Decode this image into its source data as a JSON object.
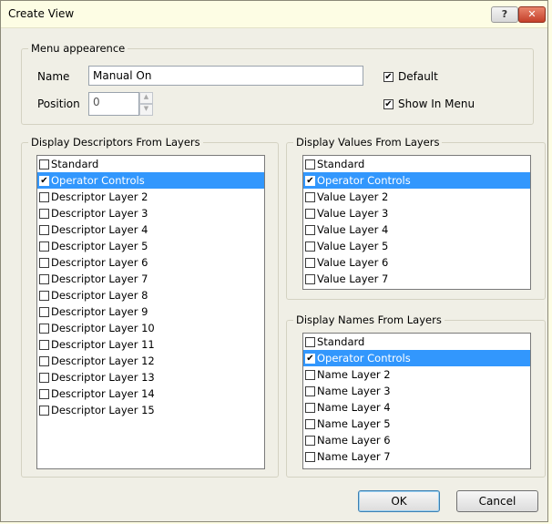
{
  "window": {
    "title": "Create View",
    "help_glyph": "?",
    "close_glyph": "✕"
  },
  "menu_appearance": {
    "group_label": "Menu appearence",
    "name_label": "Name",
    "name_value": "Manual On",
    "position_label": "Position",
    "position_value": "0",
    "default_label": "Default",
    "default_checked": true,
    "show_in_menu_label": "Show In Menu",
    "show_in_menu_checked": true
  },
  "descriptors": {
    "group_label": "Display Descriptors From Layers",
    "items": [
      {
        "label": "Standard",
        "checked": false,
        "selected": false
      },
      {
        "label": "Operator Controls",
        "checked": true,
        "selected": true
      },
      {
        "label": "Descriptor Layer 2",
        "checked": false,
        "selected": false
      },
      {
        "label": "Descriptor Layer 3",
        "checked": false,
        "selected": false
      },
      {
        "label": "Descriptor Layer 4",
        "checked": false,
        "selected": false
      },
      {
        "label": "Descriptor Layer 5",
        "checked": false,
        "selected": false
      },
      {
        "label": "Descriptor Layer 6",
        "checked": false,
        "selected": false
      },
      {
        "label": "Descriptor Layer 7",
        "checked": false,
        "selected": false
      },
      {
        "label": "Descriptor Layer 8",
        "checked": false,
        "selected": false
      },
      {
        "label": "Descriptor Layer 9",
        "checked": false,
        "selected": false
      },
      {
        "label": "Descriptor Layer 10",
        "checked": false,
        "selected": false
      },
      {
        "label": "Descriptor Layer 11",
        "checked": false,
        "selected": false
      },
      {
        "label": "Descriptor Layer 12",
        "checked": false,
        "selected": false
      },
      {
        "label": "Descriptor Layer 13",
        "checked": false,
        "selected": false
      },
      {
        "label": "Descriptor Layer 14",
        "checked": false,
        "selected": false
      },
      {
        "label": "Descriptor Layer 15",
        "checked": false,
        "selected": false
      }
    ]
  },
  "values": {
    "group_label": "Display Values From Layers",
    "items": [
      {
        "label": "Standard",
        "checked": false,
        "selected": false
      },
      {
        "label": "Operator Controls",
        "checked": true,
        "selected": true
      },
      {
        "label": "Value Layer 2",
        "checked": false,
        "selected": false
      },
      {
        "label": "Value Layer 3",
        "checked": false,
        "selected": false
      },
      {
        "label": "Value Layer 4",
        "checked": false,
        "selected": false
      },
      {
        "label": "Value Layer 5",
        "checked": false,
        "selected": false
      },
      {
        "label": "Value Layer 6",
        "checked": false,
        "selected": false
      },
      {
        "label": "Value Layer 7",
        "checked": false,
        "selected": false
      }
    ]
  },
  "names": {
    "group_label": "Display Names From Layers",
    "items": [
      {
        "label": "Standard",
        "checked": false,
        "selected": false
      },
      {
        "label": "Operator Controls",
        "checked": true,
        "selected": true
      },
      {
        "label": "Name Layer 2",
        "checked": false,
        "selected": false
      },
      {
        "label": "Name Layer 3",
        "checked": false,
        "selected": false
      },
      {
        "label": "Name Layer 4",
        "checked": false,
        "selected": false
      },
      {
        "label": "Name Layer 5",
        "checked": false,
        "selected": false
      },
      {
        "label": "Name Layer 6",
        "checked": false,
        "selected": false
      },
      {
        "label": "Name Layer 7",
        "checked": false,
        "selected": false
      }
    ]
  },
  "buttons": {
    "ok_label": "OK",
    "cancel_label": "Cancel"
  },
  "icons": {
    "checkmark": "✔",
    "spin_up": "▲",
    "spin_down": "▼"
  },
  "colors": {
    "selection": "#3297fd",
    "background": "#f0efe6",
    "title_bar": "#fdfde4"
  }
}
